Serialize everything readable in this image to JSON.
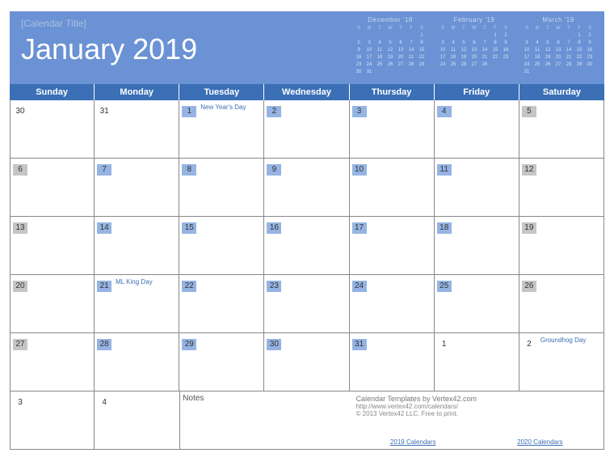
{
  "header": {
    "placeholder": "[Calendar Title]",
    "title": "January 2019",
    "minis": [
      {
        "label": "December '18",
        "rows": [
          [
            "S",
            "M",
            "T",
            "W",
            "T",
            "F",
            "S"
          ],
          [
            "",
            "",
            "",
            "",
            "",
            "",
            "1"
          ],
          [
            "2",
            "3",
            "4",
            "5",
            "6",
            "7",
            "8"
          ],
          [
            "9",
            "10",
            "11",
            "12",
            "13",
            "14",
            "15"
          ],
          [
            "16",
            "17",
            "18",
            "19",
            "20",
            "21",
            "22"
          ],
          [
            "23",
            "24",
            "25",
            "26",
            "27",
            "28",
            "29"
          ],
          [
            "30",
            "31",
            "",
            "",
            "",
            "",
            ""
          ]
        ]
      },
      {
        "label": "February '19",
        "rows": [
          [
            "S",
            "M",
            "T",
            "W",
            "T",
            "F",
            "S"
          ],
          [
            "",
            "",
            "",
            "",
            "",
            "1",
            "2"
          ],
          [
            "3",
            "4",
            "5",
            "6",
            "7",
            "8",
            "9"
          ],
          [
            "10",
            "11",
            "12",
            "13",
            "14",
            "15",
            "16"
          ],
          [
            "17",
            "18",
            "19",
            "20",
            "21",
            "22",
            "23"
          ],
          [
            "24",
            "25",
            "26",
            "27",
            "28",
            "",
            ""
          ]
        ]
      },
      {
        "label": "March '19",
        "rows": [
          [
            "S",
            "M",
            "T",
            "W",
            "T",
            "F",
            "S"
          ],
          [
            "",
            "",
            "",
            "",
            "",
            "1",
            "2"
          ],
          [
            "3",
            "4",
            "5",
            "6",
            "7",
            "8",
            "9"
          ],
          [
            "10",
            "11",
            "12",
            "13",
            "14",
            "15",
            "16"
          ],
          [
            "17",
            "18",
            "19",
            "20",
            "21",
            "22",
            "23"
          ],
          [
            "24",
            "25",
            "26",
            "27",
            "28",
            "29",
            "30"
          ],
          [
            "31",
            "",
            "",
            "",
            "",
            "",
            ""
          ]
        ]
      }
    ]
  },
  "dayNames": [
    "Sunday",
    "Monday",
    "Tuesday",
    "Wednesday",
    "Thursday",
    "Friday",
    "Saturday"
  ],
  "cells": [
    {
      "n": "30",
      "cls": "plain"
    },
    {
      "n": "31",
      "cls": "plain"
    },
    {
      "n": "1",
      "cls": "blue",
      "evt": "New Year's Day"
    },
    {
      "n": "2",
      "cls": "blue"
    },
    {
      "n": "3",
      "cls": "blue"
    },
    {
      "n": "4",
      "cls": "blue"
    },
    {
      "n": "5",
      "cls": "gray"
    },
    {
      "n": "6",
      "cls": "gray"
    },
    {
      "n": "7",
      "cls": "blue"
    },
    {
      "n": "8",
      "cls": "blue"
    },
    {
      "n": "9",
      "cls": "blue"
    },
    {
      "n": "10",
      "cls": "blue"
    },
    {
      "n": "11",
      "cls": "blue"
    },
    {
      "n": "12",
      "cls": "gray"
    },
    {
      "n": "13",
      "cls": "gray"
    },
    {
      "n": "14",
      "cls": "blue"
    },
    {
      "n": "15",
      "cls": "blue"
    },
    {
      "n": "16",
      "cls": "blue"
    },
    {
      "n": "17",
      "cls": "blue"
    },
    {
      "n": "18",
      "cls": "blue"
    },
    {
      "n": "19",
      "cls": "gray"
    },
    {
      "n": "20",
      "cls": "gray"
    },
    {
      "n": "21",
      "cls": "blue",
      "evt": "ML King Day"
    },
    {
      "n": "22",
      "cls": "blue"
    },
    {
      "n": "23",
      "cls": "blue"
    },
    {
      "n": "24",
      "cls": "blue"
    },
    {
      "n": "25",
      "cls": "blue"
    },
    {
      "n": "26",
      "cls": "gray"
    },
    {
      "n": "27",
      "cls": "gray"
    },
    {
      "n": "28",
      "cls": "blue"
    },
    {
      "n": "29",
      "cls": "blue"
    },
    {
      "n": "30",
      "cls": "blue"
    },
    {
      "n": "31",
      "cls": "blue"
    },
    {
      "n": "1",
      "cls": "plain"
    },
    {
      "n": "2",
      "cls": "plain",
      "evt": "Groundhog Day"
    }
  ],
  "lastRow": {
    "c1": "3",
    "c2": "4",
    "notesLabel": "Notes",
    "info": {
      "line1": "Calendar Templates by Vertex42.com",
      "line2": "http://www.vertex42.com/calendars/",
      "line3": "© 2013 Vertex42 LLC. Free to print.",
      "link1": "2019 Calendars",
      "link2": "2020 Calendars"
    }
  }
}
